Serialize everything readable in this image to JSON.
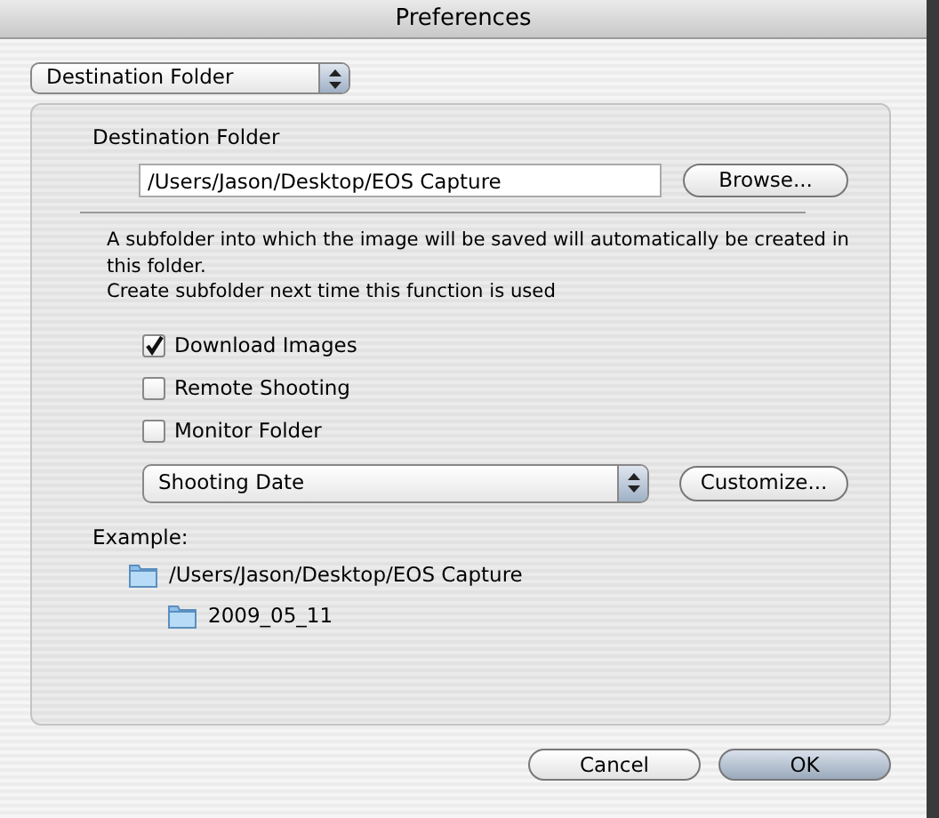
{
  "window": {
    "title": "Preferences"
  },
  "category": {
    "value": "Destination Folder"
  },
  "destination": {
    "label": "Destination Folder",
    "path": "/Users/Jason/Desktop/EOS Capture",
    "browse_button": "Browse..."
  },
  "description": [
    "A subfolder into which the image will be saved will automatically be created in this folder.",
    "Create subfolder next time this function is used"
  ],
  "options": [
    {
      "label": "Download Images",
      "checked": true
    },
    {
      "label": "Remote Shooting",
      "checked": false
    },
    {
      "label": "Monitor Folder",
      "checked": false
    }
  ],
  "subfolder": {
    "value": "Shooting Date",
    "customize_button": "Customize..."
  },
  "example": {
    "label": "Example:",
    "tree": [
      {
        "name": "/Users/Jason/Desktop/EOS Capture",
        "children": [
          {
            "name": "2009_05_11"
          }
        ]
      }
    ]
  },
  "buttons": [
    {
      "label": "Cancel",
      "default": false
    },
    {
      "label": "OK",
      "default": true
    }
  ]
}
